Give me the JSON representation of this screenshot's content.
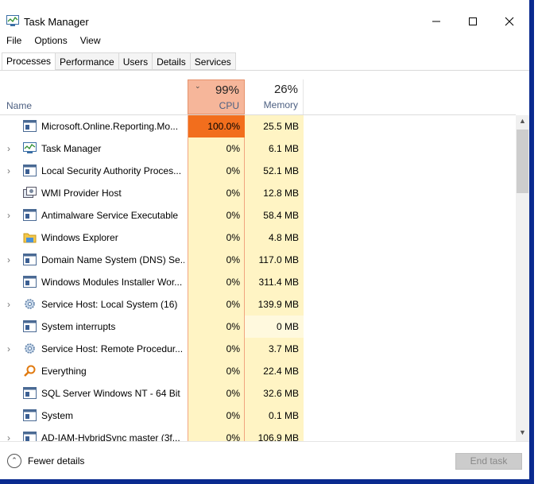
{
  "window": {
    "title": "Task Manager"
  },
  "menu": [
    "File",
    "Options",
    "View"
  ],
  "tabs": [
    "Processes",
    "Performance",
    "Users",
    "Details",
    "Services"
  ],
  "header": {
    "name": "Name",
    "cpu_pct": "99%",
    "cpu_label": "CPU",
    "mem_pct": "26%",
    "mem_label": "Memory"
  },
  "rows": [
    {
      "name": "Microsoft.Online.Reporting.Mo...",
      "cpu": "100.0%",
      "mem": "25.5 MB",
      "expand": false,
      "icon": "service-window-icon"
    },
    {
      "name": "Task Manager",
      "cpu": "0%",
      "mem": "6.1 MB",
      "expand": true,
      "icon": "task-manager-icon"
    },
    {
      "name": "Local Security Authority Proces...",
      "cpu": "0%",
      "mem": "52.1 MB",
      "expand": true,
      "icon": "service-window-icon"
    },
    {
      "name": "WMI Provider Host",
      "cpu": "0%",
      "mem": "12.8 MB",
      "expand": false,
      "icon": "wmi-icon"
    },
    {
      "name": "Antimalware Service Executable",
      "cpu": "0%",
      "mem": "58.4 MB",
      "expand": true,
      "icon": "service-window-icon"
    },
    {
      "name": "Windows Explorer",
      "cpu": "0%",
      "mem": "4.8 MB",
      "expand": false,
      "icon": "folder-icon"
    },
    {
      "name": "Domain Name System (DNS) Se...",
      "cpu": "0%",
      "mem": "117.0 MB",
      "expand": true,
      "icon": "service-window-icon"
    },
    {
      "name": "Windows Modules Installer Wor...",
      "cpu": "0%",
      "mem": "311.4 MB",
      "expand": false,
      "icon": "service-window-icon"
    },
    {
      "name": "Service Host: Local System (16)",
      "cpu": "0%",
      "mem": "139.9 MB",
      "expand": true,
      "icon": "gear-icon"
    },
    {
      "name": "System interrupts",
      "cpu": "0%",
      "mem": "0 MB",
      "expand": false,
      "icon": "service-window-icon"
    },
    {
      "name": "Service Host: Remote Procedur...",
      "cpu": "0%",
      "mem": "3.7 MB",
      "expand": true,
      "icon": "gear-icon"
    },
    {
      "name": "Everything",
      "cpu": "0%",
      "mem": "22.4 MB",
      "expand": false,
      "icon": "magnifier-icon"
    },
    {
      "name": "SQL Server Windows NT - 64 Bit",
      "cpu": "0%",
      "mem": "32.6 MB",
      "expand": false,
      "icon": "service-window-icon"
    },
    {
      "name": "System",
      "cpu": "0%",
      "mem": "0.1 MB",
      "expand": false,
      "icon": "service-window-icon"
    },
    {
      "name": "AD-IAM-HybridSync master (3f...",
      "cpu": "0%",
      "mem": "106.9 MB",
      "expand": true,
      "icon": "service-window-icon"
    }
  ],
  "footer": {
    "fewer_details": "Fewer details",
    "end_task": "End task"
  },
  "colors": {
    "cpu_hot": "#f26e1d",
    "cpu_header": "#f6b69a",
    "column_tint": "#fff4c4",
    "frame": "#0a2a8f"
  }
}
